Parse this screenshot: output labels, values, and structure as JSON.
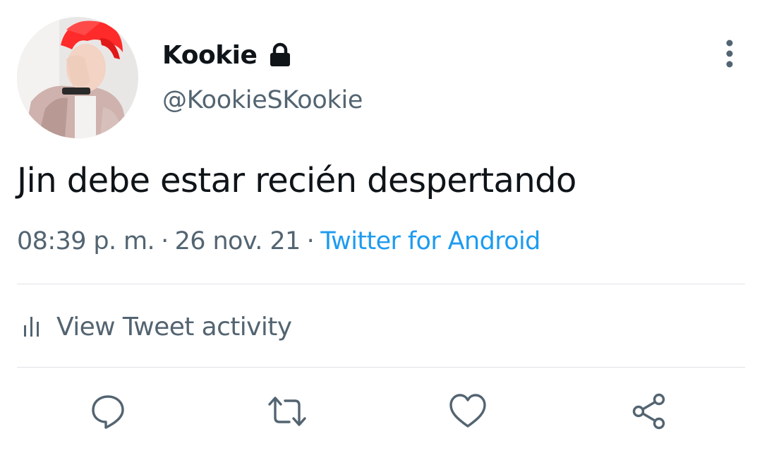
{
  "user": {
    "display_name": "Kookie",
    "handle": "@KookieSKookie",
    "protected_icon": "lock-icon",
    "avatar": "profile-photo"
  },
  "tweet": {
    "text": "Jin debe estar recién despertando",
    "time": "08:39 p. m.",
    "separator": "·",
    "date": "26 nov. 21",
    "source": "Twitter for Android"
  },
  "activity": {
    "label": "View Tweet activity",
    "icon": "bar-chart-icon"
  },
  "actions": [
    {
      "icon": "reply-icon"
    },
    {
      "icon": "retweet-icon"
    },
    {
      "icon": "like-icon"
    },
    {
      "icon": "share-icon"
    }
  ],
  "menu_icon": "more-vertical-icon",
  "colors": {
    "text_primary": "#0f1419",
    "text_secondary": "#536471",
    "link": "#1d9bf0",
    "divider": "#dfe3e7",
    "icon": "#536471"
  }
}
